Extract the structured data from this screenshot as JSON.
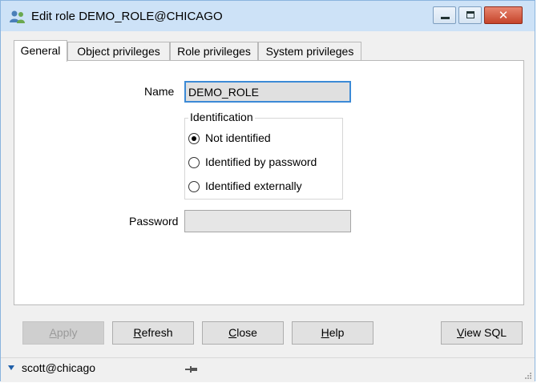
{
  "window": {
    "title": "Edit role DEMO_ROLE@CHICAGO",
    "icon": "role-users-icon",
    "controls": {
      "minimize": "minimize-icon",
      "maximize": "maximize-icon",
      "close": "close-icon"
    }
  },
  "tabs": [
    {
      "label": "General",
      "active": true
    },
    {
      "label": "Object privileges",
      "active": false
    },
    {
      "label": "Role privileges",
      "active": false
    },
    {
      "label": "System privileges",
      "active": false
    }
  ],
  "general": {
    "name_label": "Name",
    "name_value": "DEMO_ROLE",
    "identification": {
      "title": "Identification",
      "options": [
        {
          "label": "Not identified",
          "selected": true
        },
        {
          "label": "Identified by password",
          "selected": false
        },
        {
          "label": "Identified externally",
          "selected": false
        }
      ]
    },
    "password_label": "Password",
    "password_value": ""
  },
  "buttons": {
    "apply": {
      "pre": "",
      "key": "A",
      "post": "pply",
      "enabled": false
    },
    "refresh": {
      "pre": "",
      "key": "R",
      "post": "efresh",
      "enabled": true
    },
    "close": {
      "pre": "",
      "key": "C",
      "post": "lose",
      "enabled": true
    },
    "help": {
      "pre": "",
      "key": "H",
      "post": "elp",
      "enabled": true
    },
    "view_sql": {
      "pre": "",
      "key": "V",
      "post": "iew SQL",
      "enabled": true
    }
  },
  "status": {
    "connection": "scott@chicago",
    "icons": [
      "dropdown-caret-icon",
      "pin-icon",
      "resize-grip-icon"
    ]
  },
  "colors": {
    "titlebar": "#cde2f7",
    "close_button": "#c5432a",
    "focus_border": "#3c8ad6"
  }
}
